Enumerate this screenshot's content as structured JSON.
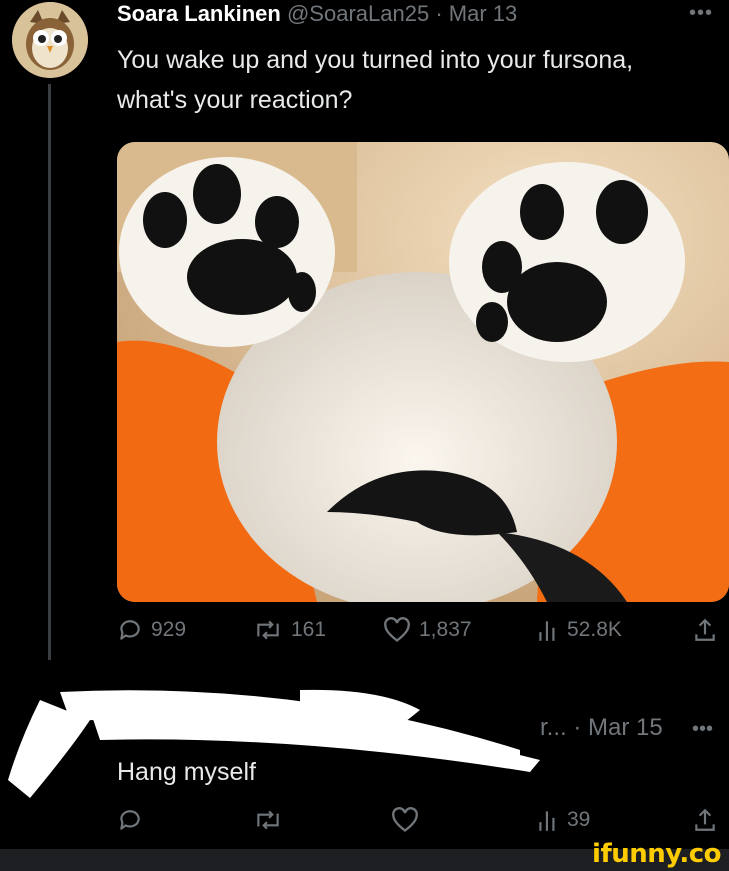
{
  "tweet": {
    "author_name": "Soara Lankinen",
    "author_handle": "@SoaraLan25",
    "separator": "·",
    "date": "Mar 13",
    "more_icon": "more-horizontal-icon",
    "text": "You wake up and you turned into your fursona, what's your reaction?",
    "image_description_icon": "fursuit-paws-photo",
    "stats": {
      "replies": "929",
      "reposts": "161",
      "likes": "1,837",
      "views": "52.8K"
    }
  },
  "reply": {
    "truncated_name": "r...",
    "separator": "·",
    "date": "Mar 15",
    "text": "Hang myself",
    "stats": {
      "views": "39"
    }
  },
  "watermark": {
    "text": "ifunny.co",
    "color": "#ffcc00"
  },
  "colors": {
    "background": "#000000",
    "muted": "#71767b",
    "text": "#e7e9ea",
    "orange_fur": "#f26a12"
  }
}
